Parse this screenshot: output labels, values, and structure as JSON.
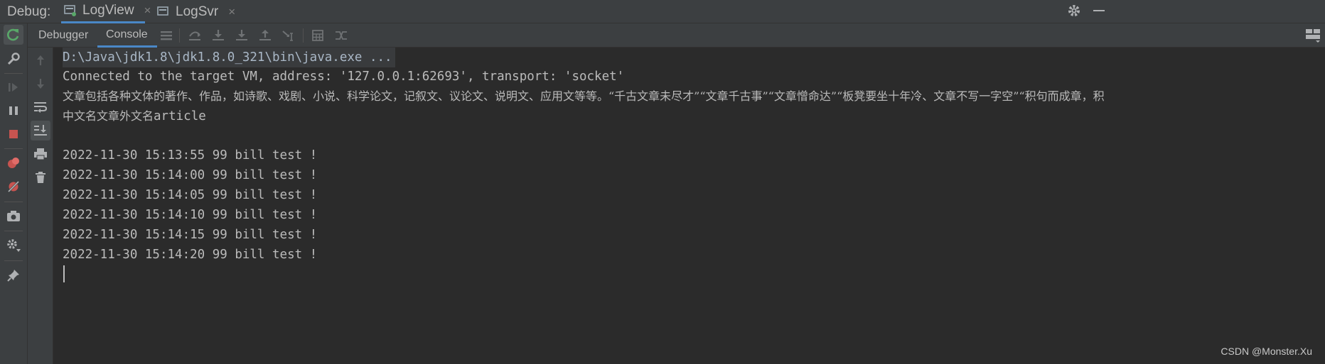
{
  "topbar": {
    "debug_label": "Debug:",
    "tabs": [
      {
        "label": "LogView",
        "active": true
      },
      {
        "label": "LogSvr",
        "active": false
      }
    ],
    "close_glyph": "×"
  },
  "inner_tabs": [
    {
      "label": "Debugger",
      "active": false
    },
    {
      "label": "Console",
      "active": true
    }
  ],
  "console": {
    "command_line": "D:\\Java\\jdk1.8\\jdk1.8.0_321\\bin\\java.exe ...",
    "connected_line": "Connected to the target VM, address: '127.0.0.1:62693', transport: 'socket'",
    "cjk_line_1": "文章包括各种文体的著作、作品，如诗歌、戏剧、小说、科学论文，记叙文、议论文、说明文、应用文等等。“千古文章未尽才”“文章千古事”“文章憎命达”“板凳要坐十年冷、文章不写一字空”“积句而成章，积",
    "cjk_line_2": "中文名文章外文名article",
    "log_lines": [
      "2022-11-30 15:13:55 99 bill test !",
      "2022-11-30 15:14:00 99 bill test !",
      "2022-11-30 15:14:05 99 bill test !",
      "2022-11-30 15:14:10 99 bill test !",
      "2022-11-30 15:14:15 99 bill test !",
      "2022-11-30 15:14:20 99 bill test !"
    ]
  },
  "watermark": "CSDN @Monster.Xu",
  "colors": {
    "accent_tab": "#4a88c7",
    "resume_green": "#59a869",
    "stop_red": "#c75450",
    "background": "#2b2b2b",
    "panel": "#3c3f41"
  }
}
